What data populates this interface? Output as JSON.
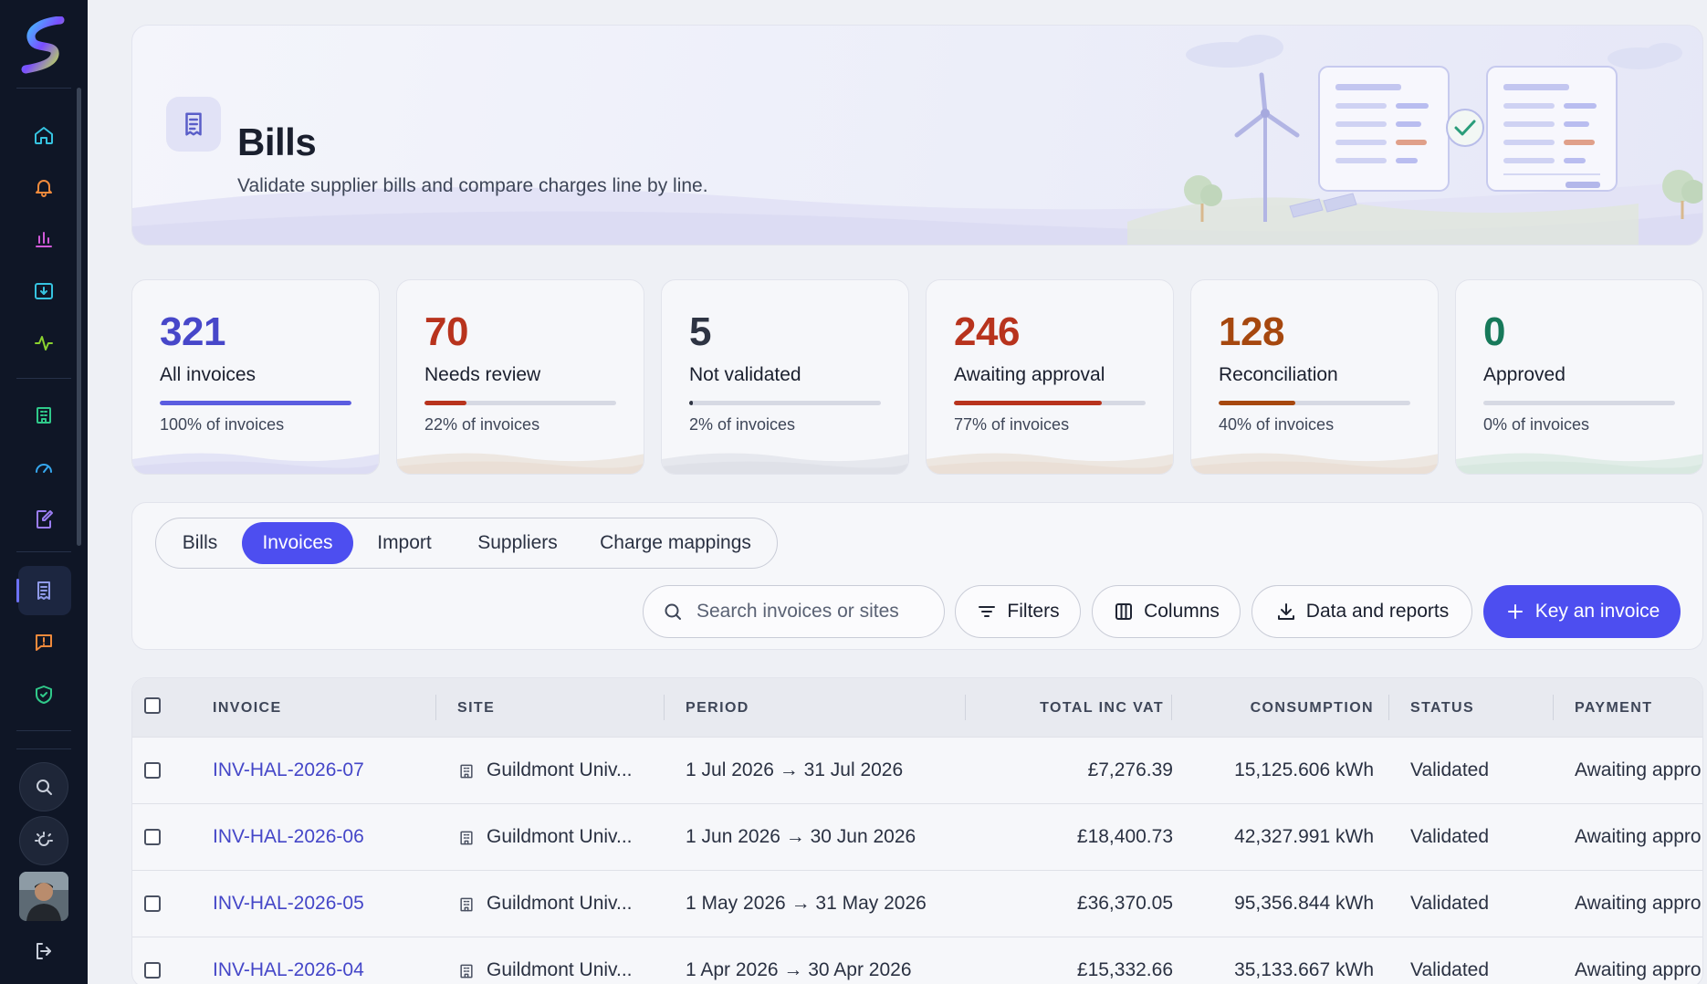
{
  "sidebar": {
    "icons": [
      {
        "name": "home-icon",
        "color": "#36c3e0"
      },
      {
        "name": "bell-icon",
        "color": "#f08a3c"
      },
      {
        "name": "bar-chart-icon",
        "color": "#d05ad8"
      },
      {
        "name": "inbox-download-icon",
        "color": "#36c3e0"
      },
      {
        "name": "activity-icon",
        "color": "#8ad12f"
      },
      {
        "name": "building-icon",
        "color": "#30c98a"
      },
      {
        "name": "gauge-icon",
        "color": "#36a8f0"
      },
      {
        "name": "edit-document-icon",
        "color": "#9b7df2"
      },
      {
        "name": "receipt-icon",
        "color": "#8f9ae8"
      },
      {
        "name": "alert-message-icon",
        "color": "#f08a3c"
      },
      {
        "name": "shield-check-icon",
        "color": "#30c98a"
      }
    ],
    "bottom": [
      "search-icon",
      "theme-toggle-icon",
      "avatar",
      "logout-icon"
    ]
  },
  "hero": {
    "title": "Bills",
    "subtitle": "Validate supplier bills and compare charges line by line."
  },
  "stats": [
    {
      "value": "321",
      "label": "All invoices",
      "percent_label": "100% of invoices",
      "fraction": 1.0,
      "color": "#4747c9",
      "bar_color": "#5b5de0"
    },
    {
      "value": "70",
      "label": "Needs review",
      "percent_label": "22% of invoices",
      "fraction": 0.22,
      "color": "#b8331d",
      "bar_color": "#b8331d"
    },
    {
      "value": "5",
      "label": "Not validated",
      "percent_label": "2% of invoices",
      "fraction": 0.02,
      "color": "#2e3443",
      "bar_color": "#2e3443"
    },
    {
      "value": "246",
      "label": "Awaiting approval",
      "percent_label": "77% of invoices",
      "fraction": 0.77,
      "color": "#b8331d",
      "bar_color": "#b8331d"
    },
    {
      "value": "128",
      "label": "Reconciliation",
      "percent_label": "40% of invoices",
      "fraction": 0.4,
      "color": "#a6480f",
      "bar_color": "#a6480f"
    },
    {
      "value": "0",
      "label": "Approved",
      "percent_label": "0% of invoices",
      "fraction": 0.0,
      "color": "#17795a",
      "bar_color": "#17795a"
    }
  ],
  "tabs": [
    {
      "label": "Bills",
      "active": false
    },
    {
      "label": "Invoices",
      "active": true
    },
    {
      "label": "Import",
      "active": false
    },
    {
      "label": "Suppliers",
      "active": false
    },
    {
      "label": "Charge mappings",
      "active": false
    }
  ],
  "toolbar": {
    "search_placeholder": "Search invoices or sites",
    "filters_label": "Filters",
    "columns_label": "Columns",
    "data_reports_label": "Data and reports",
    "key_invoice_label": "Key an invoice"
  },
  "table": {
    "headers": [
      "INVOICE",
      "SITE",
      "PERIOD",
      "TOTAL INC VAT",
      "CONSUMPTION",
      "STATUS",
      "PAYMENT"
    ],
    "rows": [
      {
        "invoice": "INV-HAL-2026-07",
        "site": "Guildmont Univ...",
        "period": "1 Jul 2026 → 31 Jul 2026",
        "total": "£7,276.39",
        "consumption": "15,125.606 kWh",
        "status": "Validated",
        "payment": "Awaiting appro"
      },
      {
        "invoice": "INV-HAL-2026-06",
        "site": "Guildmont Univ...",
        "period": "1 Jun 2026 → 30 Jun 2026",
        "total": "£18,400.73",
        "consumption": "42,327.991 kWh",
        "status": "Validated",
        "payment": "Awaiting appro"
      },
      {
        "invoice": "INV-HAL-2026-05",
        "site": "Guildmont Univ...",
        "period": "1 May 2026 → 31 May 2026",
        "total": "£36,370.05",
        "consumption": "95,356.844 kWh",
        "status": "Validated",
        "payment": "Awaiting appro"
      },
      {
        "invoice": "INV-HAL-2026-04",
        "site": "Guildmont Univ...",
        "period": "1 Apr 2026 → 30 Apr 2026",
        "total": "£15,332.66",
        "consumption": "35,133.667 kWh",
        "status": "Validated",
        "payment": "Awaiting appro"
      }
    ]
  }
}
